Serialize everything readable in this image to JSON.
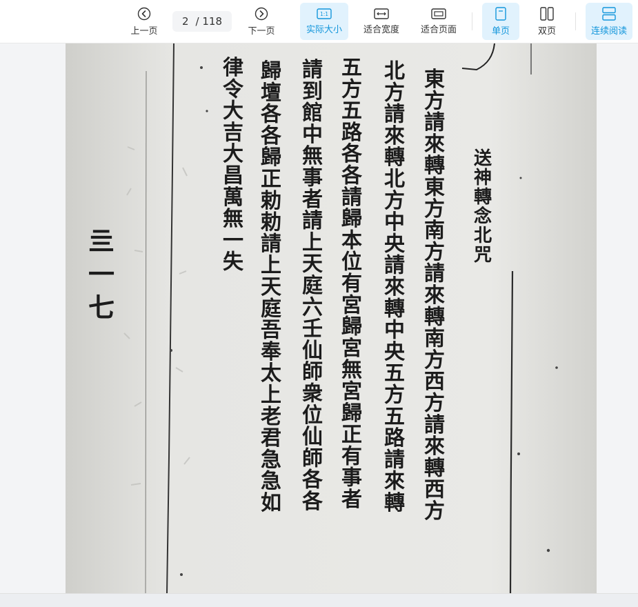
{
  "toolbar": {
    "prev_label": "上一页",
    "next_label": "下一页",
    "current_page": "2",
    "page_total": "/ 118",
    "actual_size_label": "实际大小",
    "actual_size_badge": "1:1",
    "fit_width_label": "适合宽度",
    "fit_page_label": "适合页面",
    "single_page_label": "单页",
    "double_page_label": "双页",
    "continuous_label": "连续阅读",
    "accent_color": "#1296db",
    "active_bg": "#e1f2fd"
  },
  "document": {
    "header": "送神 轉念北咒",
    "columns": [
      "東方請來轉東方南方請來轉南方西方請來轉西方",
      "北方請來轉北方中央請來轉中央五方五路請來轉",
      "五方五路各各請歸本位有宮歸宮無宮歸正有事者",
      "請到館中無事者請上天庭六壬仙師衆位仙師各各",
      "歸壇各各歸正勅勅請上天庭吾奉太上老君急急如",
      "律令大吉大昌萬無一失"
    ],
    "margin_note": "亖 一七"
  }
}
